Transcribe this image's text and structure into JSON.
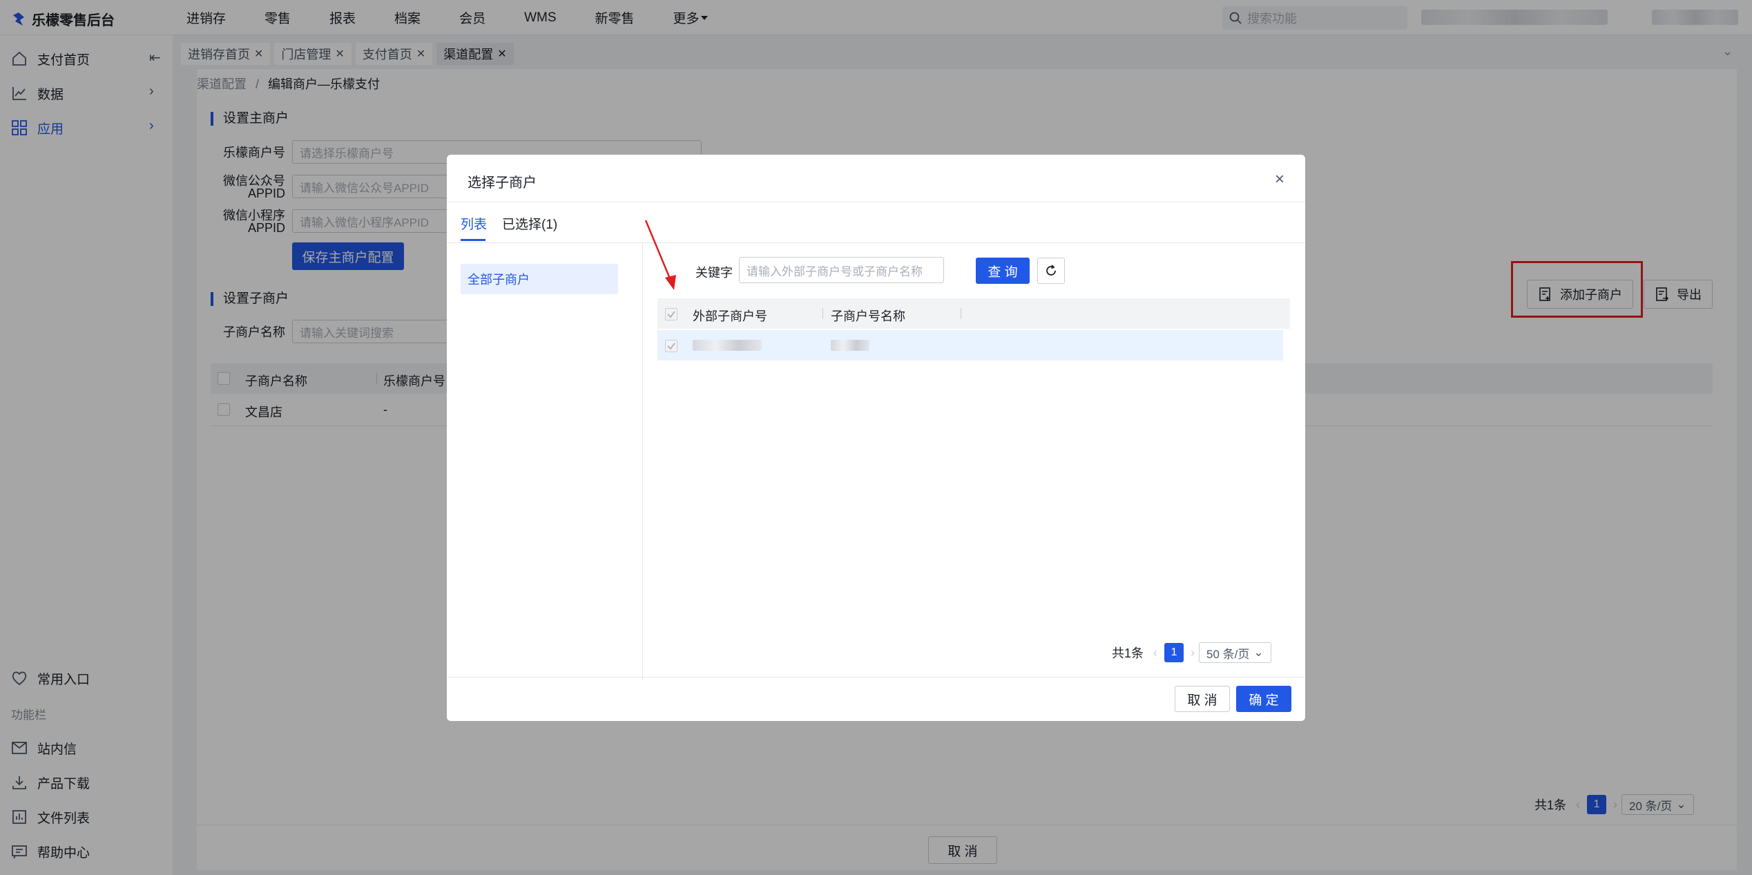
{
  "app": {
    "title": "乐檬零售后台"
  },
  "nav": [
    "进销存",
    "零售",
    "报表",
    "档案",
    "会员",
    "WMS",
    "新零售"
  ],
  "nav_more": "更多",
  "search": {
    "placeholder": "搜索功能"
  },
  "sidebar": {
    "items": [
      {
        "label": "支付首页",
        "icon": "home-icon"
      },
      {
        "label": "数据",
        "icon": "chart-icon"
      },
      {
        "label": "应用",
        "icon": "apps-icon"
      }
    ],
    "bottom": {
      "common": "常用入口",
      "section": "功能栏",
      "items": [
        "站内信",
        "产品下载",
        "文件列表",
        "帮助中心"
      ]
    }
  },
  "tabs": [
    {
      "label": "进销存首页"
    },
    {
      "label": "门店管理"
    },
    {
      "label": "支付首页"
    },
    {
      "label": "渠道配置"
    }
  ],
  "breadcrumb": {
    "parent": "渠道配置",
    "separator": "/",
    "current": "编辑商户—乐檬支付"
  },
  "main_merchant": {
    "title": "设置主商户",
    "fields": [
      {
        "label": "乐檬商户号",
        "placeholder": "请选择乐檬商户号"
      },
      {
        "label": "微信公众号APPID",
        "label1": "微信公众号",
        "label2": "APPID",
        "placeholder": "请输入微信公众号APPID"
      },
      {
        "label": "微信小程序APPID",
        "label1": "微信小程序",
        "label2": "APPID",
        "placeholder": "请输入微信小程序APPID"
      }
    ],
    "save_button": "保存主商户配置"
  },
  "sub_merchant": {
    "title": "设置子商户",
    "name_label": "子商户名称",
    "name_placeholder": "请输入关键词搜索",
    "add_button": "添加子商户",
    "export_button": "导出",
    "columns": [
      "子商户名称",
      "乐檬商户号"
    ],
    "rows": [
      {
        "name": "文昌店",
        "merchant_no": "-"
      }
    ],
    "pager": {
      "total": "共1条",
      "page": "1",
      "size": "20 条/页"
    },
    "cancel": "取 消"
  },
  "modal": {
    "title": "选择子商户",
    "tabs": [
      "列表",
      "已选择(1)"
    ],
    "side_item": "全部子商户",
    "keyword_label": "关键字",
    "keyword_placeholder": "请输入外部子商户号或子商户名称",
    "query_button": "查 询",
    "columns": [
      "外部子商户号",
      "子商户号名称"
    ],
    "pager": {
      "total": "共1条",
      "page": "1",
      "size": "50 条/页"
    },
    "cancel": "取 消",
    "confirm": "确 定"
  },
  "colors": {
    "accent": "#2258e6",
    "highlight": "#e02020"
  }
}
